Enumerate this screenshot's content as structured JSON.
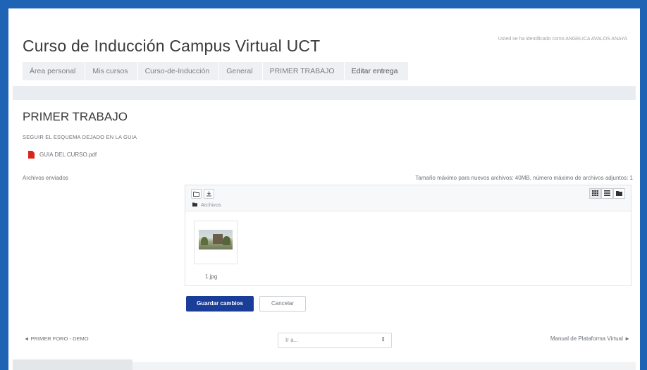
{
  "header": {
    "course_title": "Curso de Inducción Campus Virtual UCT",
    "user_note": "Usted se ha identificado como ANGELICA AVALOS ANAYA"
  },
  "breadcrumb": [
    {
      "label": "Área personal"
    },
    {
      "label": "Mis cursos"
    },
    {
      "label": "Curso-de-Inducción"
    },
    {
      "label": "General"
    },
    {
      "label": "PRIMER TRABAJO"
    },
    {
      "label": "Editar entrega"
    }
  ],
  "main": {
    "title": "PRIMER TRABAJO",
    "description": "SEGUIR EL ESQUEMA DEJADO EN LA GUIA",
    "attachment": "GUIA DEL CURSO.pdf",
    "files_label": "Archivos enviados",
    "limits": "Tamaño máximo para nuevos archivos: 40MB, número máximo de archivos adjuntos: 1"
  },
  "file_picker": {
    "toolbar": {
      "new_folder_icon": "folder-outline-icon",
      "download_icon": "download-icon"
    },
    "view_icons": [
      "grid-view-icon",
      "list-view-icon",
      "tree-view-icon"
    ],
    "path_label": "Archivos",
    "files": [
      {
        "name": "1.jpg"
      }
    ]
  },
  "actions": {
    "save_label": "Guardar cambios",
    "cancel_label": "Cancelar"
  },
  "navigation": {
    "prev_label": "◄ PRIMER FORO - DEMO",
    "jump_placeholder": "Ir a...",
    "next_label": "Manual de Plataforma Virtual ►"
  },
  "colors": {
    "primary": "#1a3d9a",
    "frame": "#1f63b5",
    "pdf": "#d9261c"
  }
}
